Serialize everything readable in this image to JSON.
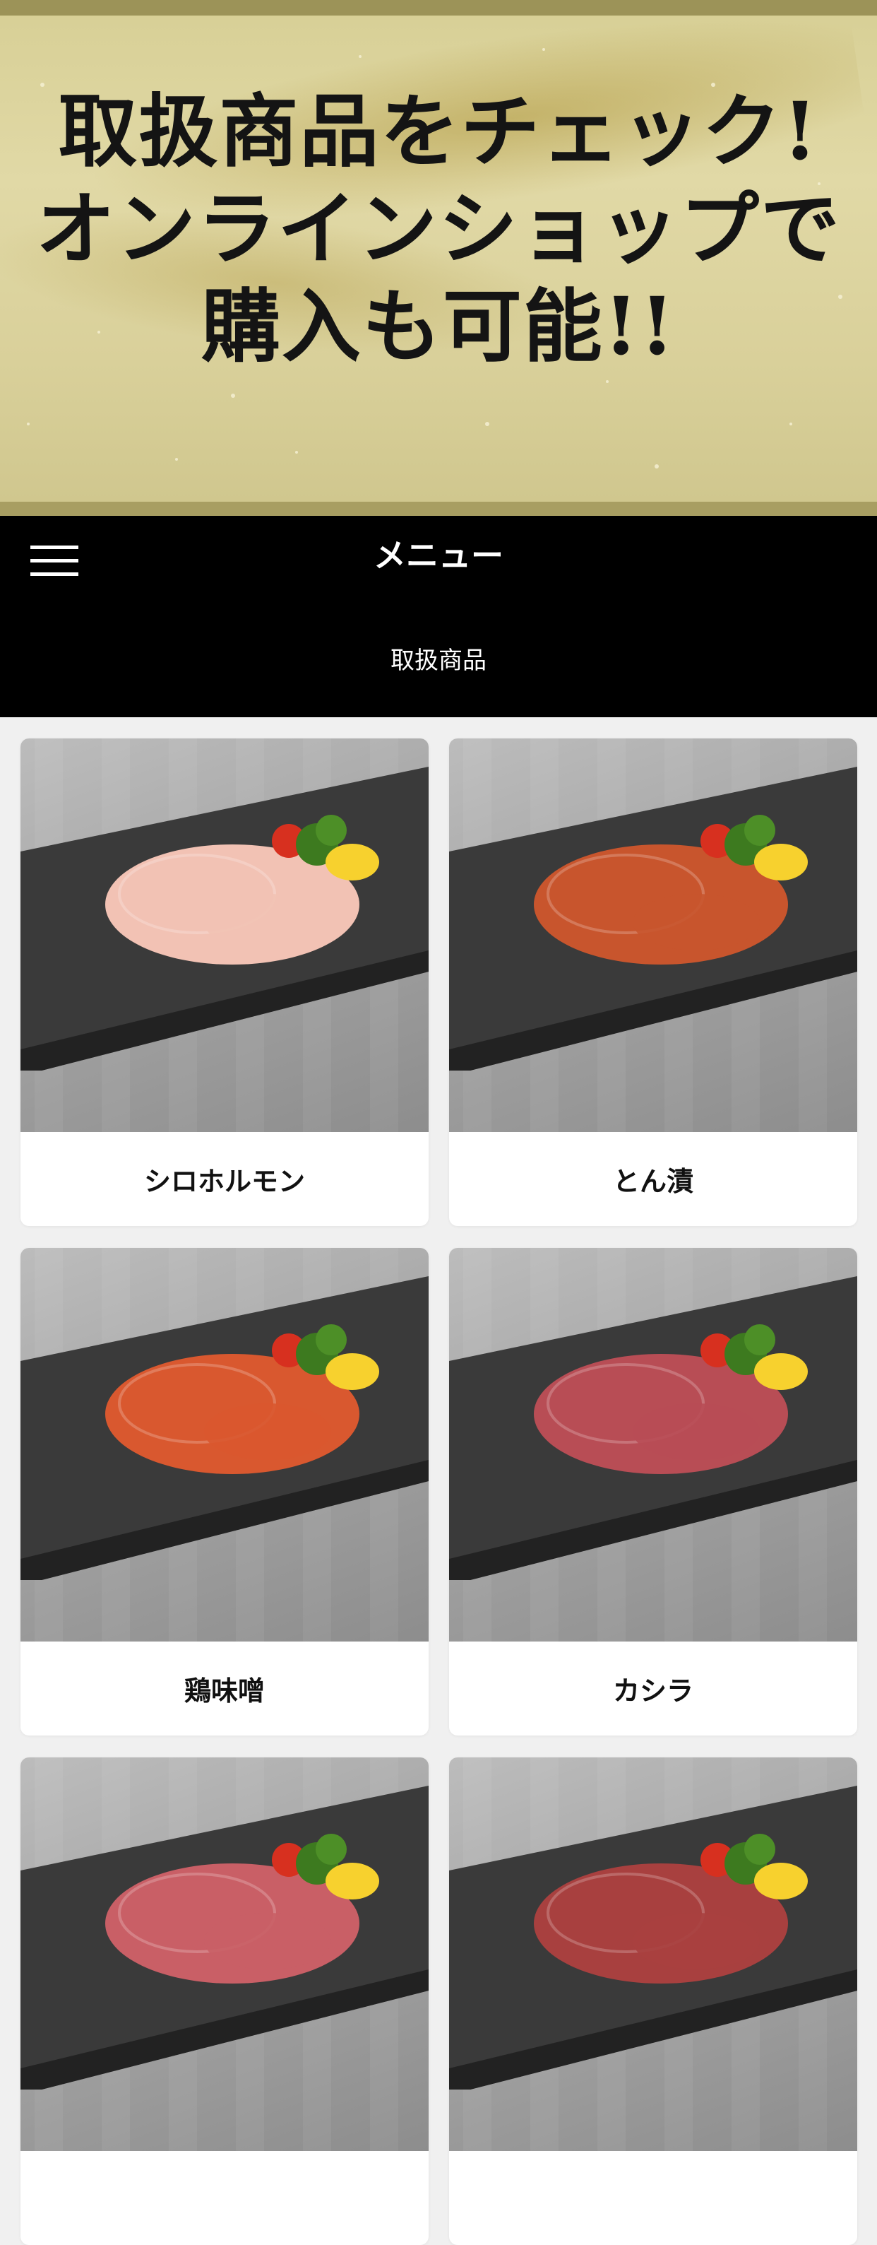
{
  "banner": {
    "lines": [
      "取扱商品をチェック!",
      "オンラインショップで",
      "購入も可能!!"
    ]
  },
  "header": {
    "menu_icon": "hamburger-icon",
    "title": "メニュー",
    "subtitle": "取扱商品"
  },
  "products": [
    {
      "name": "シロホルモン",
      "meat_color": "#f2c2b4"
    },
    {
      "name": "とん漬",
      "meat_color": "#c8552d"
    },
    {
      "name": "鶏味噌",
      "meat_color": "#d9582f"
    },
    {
      "name": "カシラ",
      "meat_color": "#b84d55"
    },
    {
      "name": "",
      "meat_color": "#c95f66"
    },
    {
      "name": "",
      "meat_color": "#a8403f"
    }
  ],
  "colors": {
    "banner_gold": "#d9d09a",
    "header_bg": "#000000",
    "page_bg": "#f0f0f0"
  }
}
